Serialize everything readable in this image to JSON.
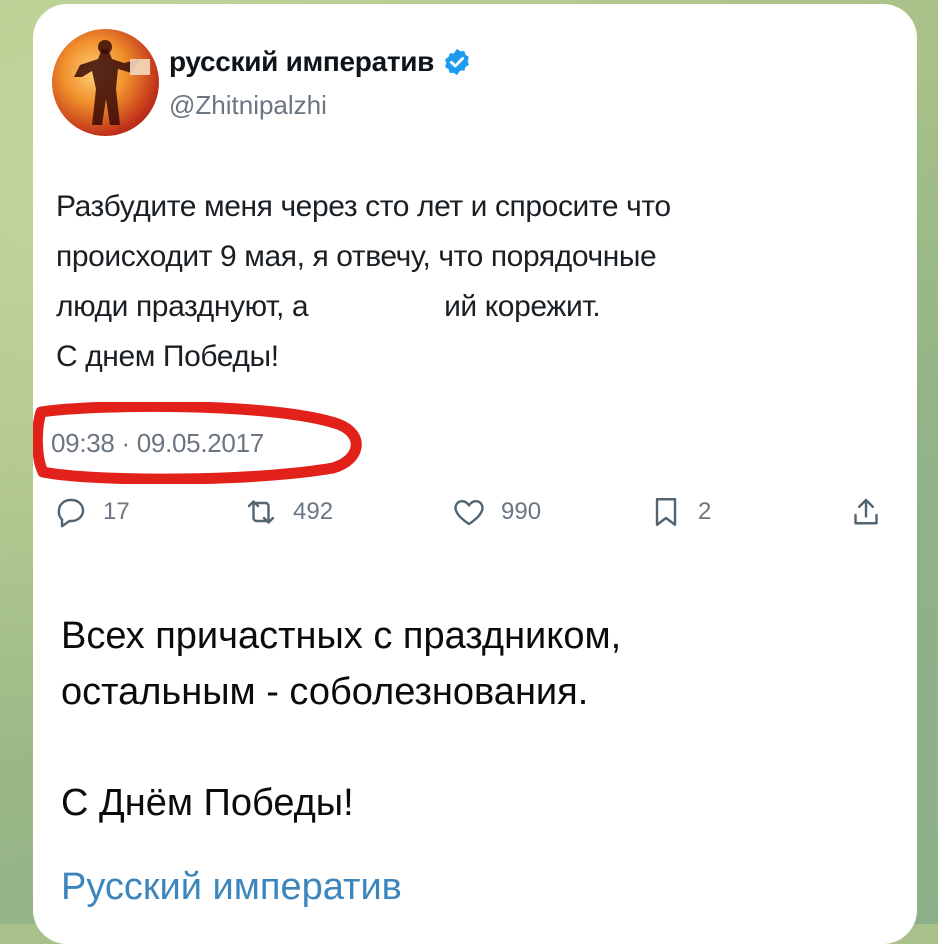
{
  "tweet": {
    "display_name": "русский императив",
    "handle": "@Zhitnipalzhi",
    "text_lines": [
      "Разбудите меня через сто лет и спросите что",
      "происходит 9 мая, я отвечу, что порядочные",
      "люди празднуют, а",
      "С днем Победы!"
    ],
    "text_line3_tail": "ий корежит.",
    "timestamp": "09:38 · 09.05.2017",
    "stats": {
      "replies": "17",
      "retweets": "492",
      "likes": "990",
      "bookmarks": "2"
    },
    "icons": [
      "reply-icon",
      "retweet-icon",
      "like-icon",
      "bookmark-icon",
      "share-icon",
      "verified-icon"
    ],
    "colors": {
      "verified": "#1d9bf0",
      "highlight_circle": "#e3211b"
    }
  },
  "message": {
    "line1": "Всех причастных с праздником,",
    "line2": "остальным - соболезнования.",
    "line3": "С Днём Победы!",
    "signature": "Русский императив",
    "colors": {
      "signature": "#3d86bd"
    }
  }
}
